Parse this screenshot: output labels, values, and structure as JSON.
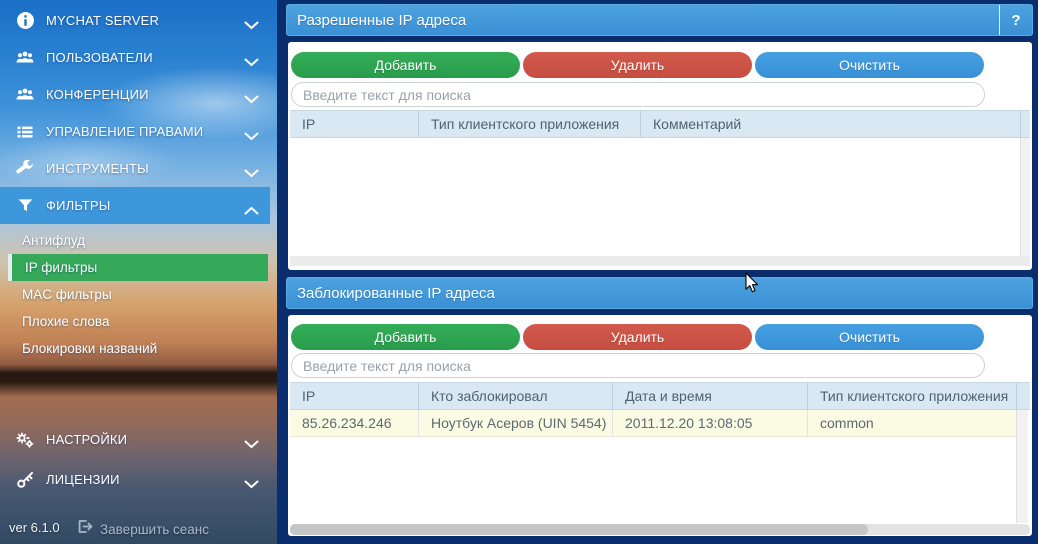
{
  "sidebar": {
    "items": [
      {
        "label": "MYCHAT SERVER",
        "icon": "info-icon"
      },
      {
        "label": "ПОЛЬЗОВАТЕЛИ",
        "icon": "users-icon"
      },
      {
        "label": "КОНФЕРЕНЦИИ",
        "icon": "conference-icon"
      },
      {
        "label": "УПРАВЛЕНИЕ ПРАВАМИ",
        "icon": "list-icon"
      },
      {
        "label": "ИНСТРУМЕНТЫ",
        "icon": "wrench-icon"
      },
      {
        "label": "ФИЛЬТРЫ",
        "icon": "filter-icon",
        "expanded": true,
        "active": true
      },
      {
        "label": "НАСТРОЙКИ",
        "icon": "gears-icon"
      },
      {
        "label": "ЛИЦЕНЗИИ",
        "icon": "key-icon"
      }
    ],
    "filter_subitems": [
      {
        "label": "Антифлуд",
        "selected": false
      },
      {
        "label": "IP фильтры",
        "selected": true
      },
      {
        "label": "MAC фильтры",
        "selected": false
      },
      {
        "label": "Плохие слова",
        "selected": false
      },
      {
        "label": "Блокировки названий",
        "selected": false
      }
    ],
    "footer": {
      "version": "ver 6.1.0",
      "logout_label": "Завершить сеанс",
      "logout_icon": "logout-icon"
    }
  },
  "panels": {
    "allowed": {
      "title": "Разрешенные IP адреса",
      "help_label": "?",
      "buttons": {
        "add": "Добавить",
        "delete": "Удалить",
        "clear": "Очистить"
      },
      "search_placeholder": "Введите текст для поиска",
      "table": {
        "columns": [
          "IP",
          "Тип клиентского приложения",
          "Комментарий"
        ],
        "rows": []
      }
    },
    "blocked": {
      "title": "Заблокированные IP адреса",
      "buttons": {
        "add": "Добавить",
        "delete": "Удалить",
        "clear": "Очистить"
      },
      "search_placeholder": "Введите текст для поиска",
      "table": {
        "columns": [
          "IP",
          "Кто заблокировал",
          "Дата и время",
          "Тип клиентского приложения"
        ],
        "rows": [
          [
            "85.26.234.246",
            "Ноутбук Асеров (UIN 5454)",
            "2011.12.20 13:08:05",
            "common"
          ]
        ]
      }
    }
  },
  "colors": {
    "background_navy": "#0a2e6d",
    "header_bar_blue": "#3d95d9",
    "button_add_green": "#2da453",
    "button_delete_red": "#cc5244",
    "button_clear_blue": "#3d98dc",
    "sidebar_active_blue": "#3f97db",
    "subitem_selected_green": "#35a85a",
    "table_header_bg": "#d9e8f2",
    "row_highlight_yellow": "#fbfbe3"
  }
}
